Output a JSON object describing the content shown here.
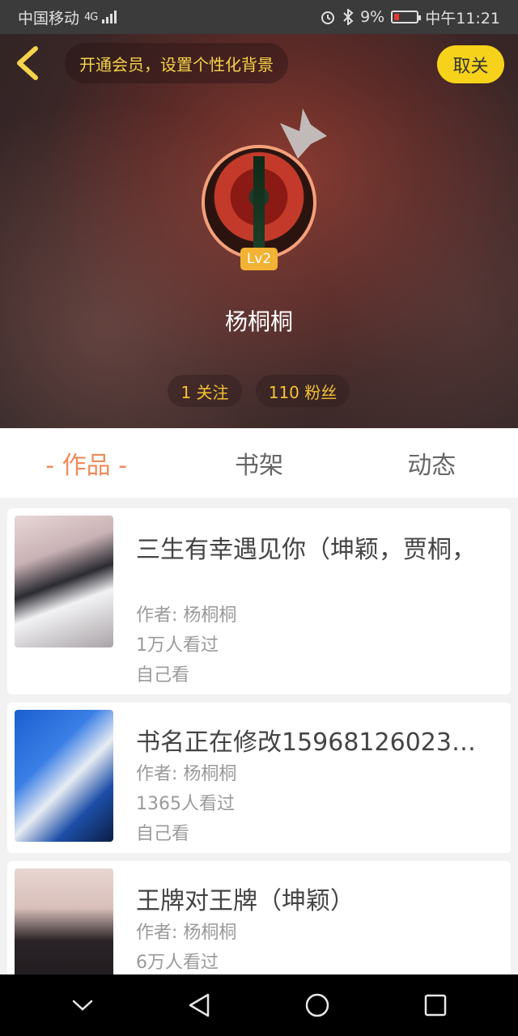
{
  "status_bar": {
    "carrier": "中国移动",
    "network": "4G",
    "battery_percent": "9%",
    "time": "中午11:21"
  },
  "header": {
    "vip_prompt": "开通会员，设置个性化背景",
    "unfollow_label": "取关",
    "level": "Lv2",
    "username": "杨桐桐",
    "following": "1 关注",
    "fans": "110 粉丝"
  },
  "tabs": [
    {
      "label": "- 作品 -",
      "active": true
    },
    {
      "label": "书架",
      "active": false
    },
    {
      "label": "动态",
      "active": false
    }
  ],
  "works": [
    {
      "title": "三生有幸遇见你（坤颖，贾桐，",
      "author": "作者: 杨桐桐",
      "views": "1万人看过",
      "visibility": "自己看"
    },
    {
      "title": "书名正在修改15968126023…",
      "author": "作者: 杨桐桐",
      "views": "1365人看过",
      "visibility": "自己看"
    },
    {
      "title": "王牌对王牌（坤颖）",
      "author": "作者: 杨桐桐",
      "views": "6万人看过",
      "visibility": ""
    }
  ],
  "colors": {
    "accent": "#f08a5a",
    "brand_yellow": "#f7d21a"
  }
}
